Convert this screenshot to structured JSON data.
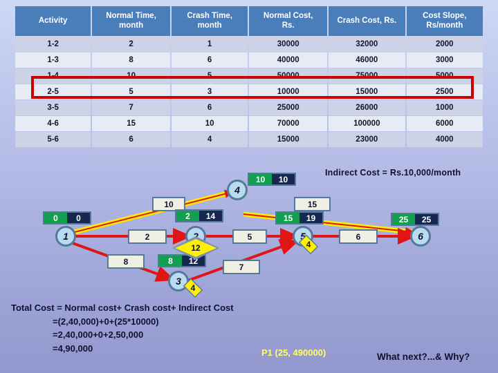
{
  "table": {
    "headers": [
      "Activity",
      "Normal Time, month",
      "Crash Time, month",
      "Normal Cost, Rs.",
      "Crash Cost, Rs.",
      "Cost Slope, Rs/month"
    ],
    "header_lines": [
      [
        "Activity",
        ""
      ],
      [
        "Normal Time,",
        "month"
      ],
      [
        "Crash Time,",
        "month"
      ],
      [
        "Normal Cost,",
        "Rs."
      ],
      [
        "Crash Cost, Rs.",
        ""
      ],
      [
        "Cost Slope,",
        "Rs/month"
      ]
    ],
    "rows": [
      {
        "activity": "1-2",
        "normal_time": "2",
        "crash_time": "1",
        "normal_cost": "30000",
        "crash_cost": "32000",
        "cost_slope": "2000"
      },
      {
        "activity": "1-3",
        "normal_time": "8",
        "crash_time": "6",
        "normal_cost": "40000",
        "crash_cost": "46000",
        "cost_slope": "3000"
      },
      {
        "activity": "1-4",
        "normal_time": "10",
        "crash_time": "5",
        "normal_cost": "50000",
        "crash_cost": "75000",
        "cost_slope": "5000"
      },
      {
        "activity": "2-5",
        "normal_time": "5",
        "crash_time": "3",
        "normal_cost": "10000",
        "crash_cost": "15000",
        "cost_slope": "2500"
      },
      {
        "activity": "3-5",
        "normal_time": "7",
        "crash_time": "6",
        "normal_cost": "25000",
        "crash_cost": "26000",
        "cost_slope": "1000"
      },
      {
        "activity": "4-6",
        "normal_time": "15",
        "crash_time": "10",
        "normal_cost": "70000",
        "crash_cost": "100000",
        "cost_slope": "6000"
      },
      {
        "activity": "5-6",
        "normal_time": "6",
        "crash_time": "4",
        "normal_cost": "15000",
        "crash_cost": "23000",
        "cost_slope": "4000"
      }
    ],
    "highlighted_row_index": 2,
    "highlight_color": "#cc0000"
  },
  "network": {
    "nodes": [
      {
        "id": "1",
        "label": "1",
        "early": "0",
        "late": "0",
        "slack": null
      },
      {
        "id": "2",
        "label": "2",
        "early": "2",
        "late": "14",
        "slack": "12"
      },
      {
        "id": "3",
        "label": "3",
        "early": "8",
        "late": "12",
        "slack": "4"
      },
      {
        "id": "4",
        "label": "4",
        "early": "10",
        "late": "10",
        "slack": null
      },
      {
        "id": "5",
        "label": "5",
        "early": "15",
        "late": "19",
        "slack": "4"
      },
      {
        "id": "6",
        "label": "6",
        "early": "25",
        "late": "25",
        "slack": null
      }
    ],
    "edges": [
      {
        "from": "1",
        "to": "2",
        "duration": "2",
        "critical": false
      },
      {
        "from": "1",
        "to": "3",
        "duration": "8",
        "critical": false
      },
      {
        "from": "1",
        "to": "4",
        "duration": "10",
        "critical": true
      },
      {
        "from": "2",
        "to": "5",
        "duration": "5",
        "critical": false
      },
      {
        "from": "3",
        "to": "5",
        "duration": "7",
        "critical": false
      },
      {
        "from": "4",
        "to": "6",
        "duration": "15",
        "critical": true
      },
      {
        "from": "5",
        "to": "6",
        "duration": "6",
        "critical": false
      }
    ],
    "colors": {
      "critical_path": "#ffee00",
      "normal_arrow": "#e01515",
      "node_fill": "#b8dced",
      "node_stroke": "#56789a",
      "early_box": "#12a050",
      "late_box": "#16284f",
      "slack_diamond": "#ffef00"
    },
    "indirect_cost_note": "Indirect Cost = Rs.10,000/month"
  },
  "calculation": {
    "line1": "Total Cost = Normal cost+  Crash cost+ Indirect Cost",
    "line2": "=(2,40,000)+0+(25*10000)",
    "line3": "=2,40,000+0+2,50,000",
    "line4": "=4,90,000"
  },
  "annotations": {
    "p1": "P1 (25, 490000)",
    "what_next": "What next?...&  Why?",
    "p1_color": "#ffff66"
  }
}
